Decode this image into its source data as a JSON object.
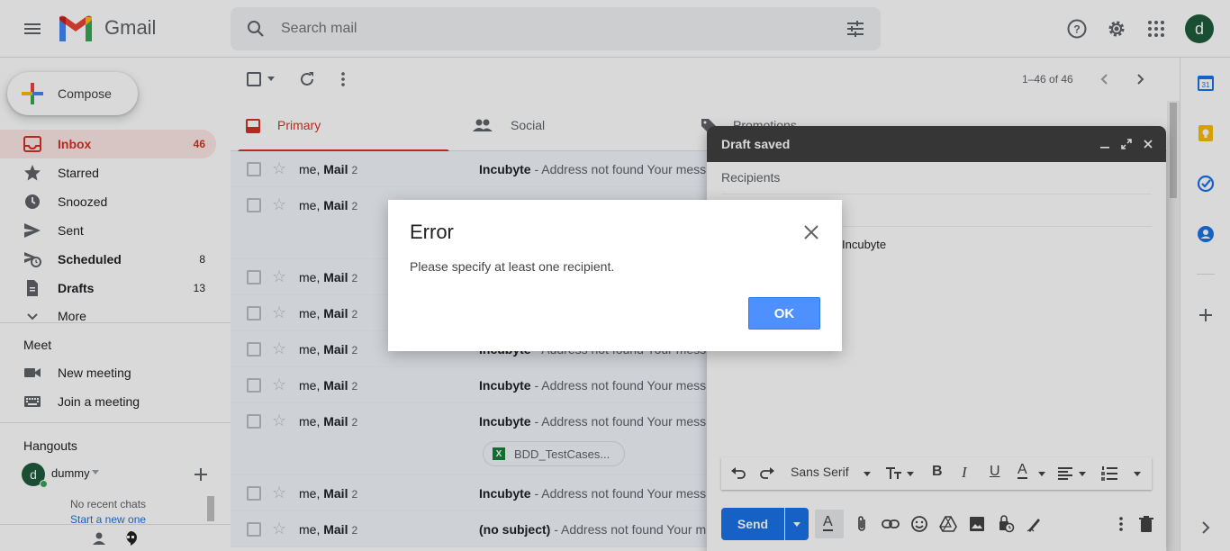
{
  "header": {
    "app_name": "Gmail",
    "search_placeholder": "Search mail",
    "avatar_letter": "d"
  },
  "sidebar": {
    "compose_label": "Compose",
    "items": [
      {
        "label": "Inbox",
        "count": "46",
        "icon": "inbox-icon"
      },
      {
        "label": "Starred",
        "count": "",
        "icon": "star-icon"
      },
      {
        "label": "Snoozed",
        "count": "",
        "icon": "clock-icon"
      },
      {
        "label": "Sent",
        "count": "",
        "icon": "send-icon"
      },
      {
        "label": "Scheduled",
        "count": "8",
        "icon": "scheduled-icon"
      },
      {
        "label": "Drafts",
        "count": "13",
        "icon": "draft-icon"
      },
      {
        "label": "More",
        "count": "",
        "icon": "chevron-down-icon"
      }
    ],
    "meet": {
      "title": "Meet",
      "items": [
        {
          "label": "New meeting",
          "icon": "video-icon"
        },
        {
          "label": "Join a meeting",
          "icon": "keyboard-icon"
        }
      ]
    },
    "hangouts": {
      "title": "Hangouts",
      "user": "dummy",
      "user_letter": "d",
      "no_chats": "No recent chats",
      "start_new": "Start a new one"
    }
  },
  "toolbar": {
    "pagination": "1–46 of 46"
  },
  "tabs": [
    {
      "label": "Primary",
      "icon": "inbox-icon"
    },
    {
      "label": "Social",
      "icon": "people-icon"
    },
    {
      "label": "Promotions",
      "icon": "tag-icon"
    }
  ],
  "emails": [
    {
      "sender_pre": "me, ",
      "sender": "Mail",
      "count": "2",
      "subject": "Incubyte",
      "snippet": " - Address not found Your mess"
    },
    {
      "sender_pre": "me, ",
      "sender": "Mail",
      "count": "2",
      "subject": "",
      "snippet": ""
    },
    {
      "sender_pre": "me, ",
      "sender": "Mail",
      "count": "2",
      "subject": "",
      "snippet": ""
    },
    {
      "sender_pre": "me, ",
      "sender": "Mail",
      "count": "2",
      "subject": "",
      "snippet": ""
    },
    {
      "sender_pre": "me, ",
      "sender": "Mail",
      "count": "2",
      "subject": "Incubyte",
      "snippet": " - Address not found Your mess"
    },
    {
      "sender_pre": "me, ",
      "sender": "Mail",
      "count": "2",
      "subject": "Incubyte",
      "snippet": " - Address not found Your mess"
    },
    {
      "sender_pre": "me, ",
      "sender": "Mail",
      "count": "2",
      "subject": "Incubyte",
      "snippet": " - Address not found Your mess",
      "attachment": "BDD_TestCases..."
    },
    {
      "sender_pre": "me, ",
      "sender": "Mail",
      "count": "2",
      "subject": "Incubyte",
      "snippet": " - Address not found Your mess"
    },
    {
      "sender_pre": "me, ",
      "sender": "Mail",
      "count": "2",
      "subject": "(no subject)",
      "snippet": " - Address not found Your m"
    }
  ],
  "compose_window": {
    "title": "Draft saved",
    "recipients_placeholder": "Recipients",
    "body_visible": "Incubyte",
    "font_name": "Sans Serif",
    "send_label": "Send"
  },
  "dialog": {
    "title": "Error",
    "message": "Please specify at least one recipient.",
    "ok_label": "OK"
  },
  "colors": {
    "accent_red": "#d93025",
    "send_blue": "#1a73e8",
    "ok_blue": "#4d90fe"
  }
}
